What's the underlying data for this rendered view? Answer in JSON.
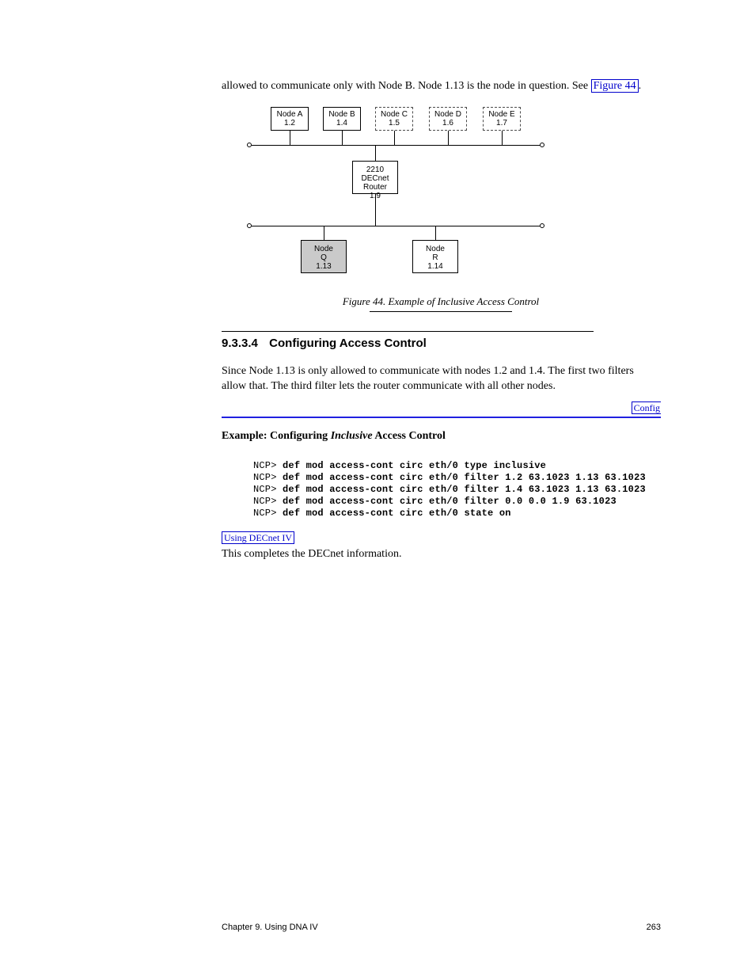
{
  "intro": {
    "p1_a": "allowed to communicate only with Node B. Node 1.13 is the node in question. See ",
    "p1_figref": "Figure 44",
    "p1_b": "."
  },
  "figure": {
    "node_a": "Node A\n1.2",
    "node_b": "Node B\n1.4",
    "node_c": "Node C\n1.5",
    "node_d": "Node D\n1.6",
    "node_e": "Node E\n1.7",
    "router": "2210\nDECnet\nRouter\n1.9",
    "q": "Node\nQ\n1.13",
    "r": "Node\nR\n1.14",
    "caption": "Figure 44. Example of Inclusive Access Control"
  },
  "section": {
    "number": "9.3.3.4",
    "title": "Configuring Access Control"
  },
  "ingress": {
    "p1": "Since Node 1.13 is only allowed to communicate with nodes 1.2 and 1.4. The first two filters allow that. The third filter lets the router communicate with all other nodes.",
    "link_right": "Config"
  },
  "example": {
    "title_a": "Example: Configuring ",
    "title_b": "Access Control",
    "title_em": "Inclusive",
    "code": [
      {
        "prompt": "NCP> ",
        "cmd": "def mod access-cont circ eth/0 type inclusive"
      },
      {
        "prompt": "NCP> ",
        "cmd": "def mod access-cont circ eth/0 filter 1.2 63.1023 1.13 63.1023"
      },
      {
        "prompt": "NCP> ",
        "cmd": "def mod access-cont circ eth/0 filter 1.4 63.1023 1.13 63.1023"
      },
      {
        "prompt": "NCP> ",
        "cmd": "def mod access-cont circ eth/0 filter 0.0 0.0 1.9 63.1023"
      },
      {
        "prompt": "NCP> ",
        "cmd": "def mod access-cont circ eth/0 state on"
      }
    ]
  },
  "outro": {
    "link_left": "Using DECnet IV",
    "p1": "This completes the DECnet information."
  },
  "footer": {
    "left": "Chapter 9. Using DNA IV",
    "right": "263"
  }
}
